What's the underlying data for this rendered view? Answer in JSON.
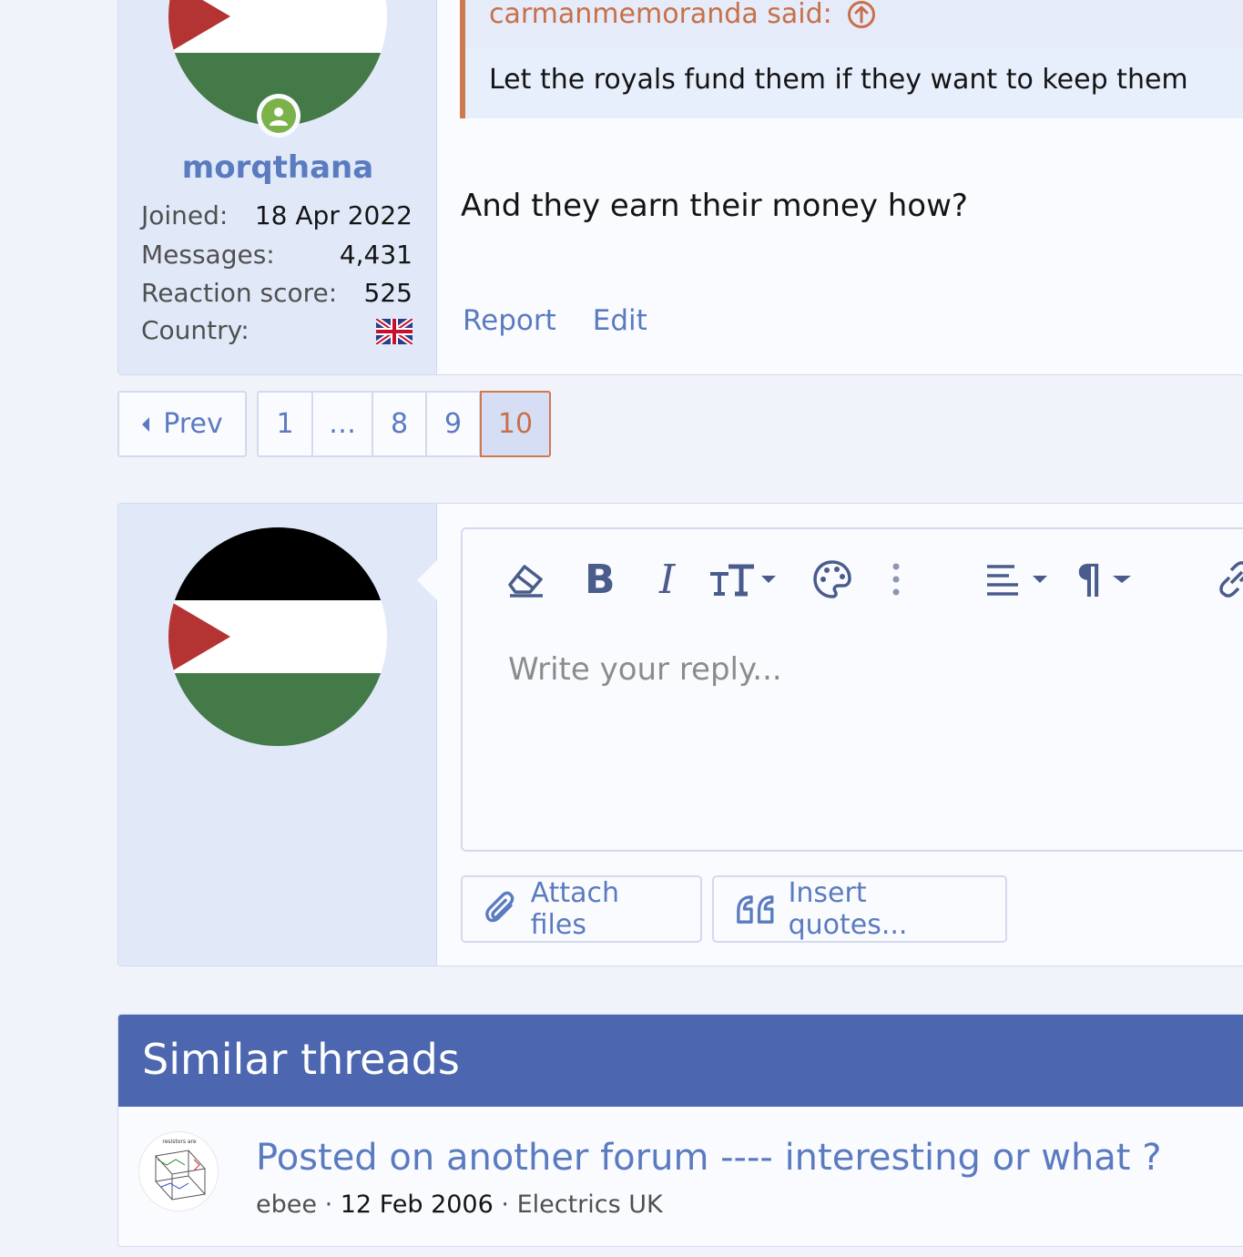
{
  "post": {
    "user": {
      "name": "morqthana",
      "joined_label": "Joined:",
      "joined_value": "18 Apr 2022",
      "messages_label": "Messages:",
      "messages_value": "4,431",
      "reaction_label": "Reaction score:",
      "reaction_value": "525",
      "country_label": "Country:",
      "country_flag_icon": "uk-flag-icon",
      "avatar_icon": "palestine-flag-avatar",
      "online_icon": "online-user-icon"
    },
    "quote": {
      "author": "carmanmemoranda said:",
      "jump_icon": "arrow-up-circle-icon",
      "text": "Let the royals fund them if they want to keep them"
    },
    "message": "And they earn their money how?",
    "actions": {
      "report": "Report",
      "edit": "Edit"
    }
  },
  "pagination": {
    "prev": "Prev",
    "pages": [
      "1",
      "…",
      "8",
      "9",
      "10"
    ],
    "current": "10"
  },
  "reply": {
    "placeholder": "Write your reply...",
    "toolbar": [
      "eraser-icon",
      "bold-icon",
      "italic-icon",
      "text-size-icon",
      "palette-icon",
      "more-vertical-icon",
      "align-icon",
      "paragraph-icon",
      "link-icon"
    ],
    "bold_glyph": "B",
    "italic_glyph": "I",
    "paragraph_glyph": "¶",
    "attach_label": "Attach files",
    "insert_quotes_label": "Insert quotes..."
  },
  "similar_threads": {
    "title": "Similar threads",
    "items": [
      {
        "title": "Posted on another forum ---- interesting or what ?",
        "author": "ebee",
        "date": "12 Feb 2006",
        "forum": "Electrics UK",
        "avatar_caption": "resistors are"
      }
    ]
  },
  "colors": {
    "accent": "#5b7bc0",
    "header_bg": "#4c67b0",
    "quote_border": "#d0784e",
    "user_pane": "#e1e9f9"
  }
}
